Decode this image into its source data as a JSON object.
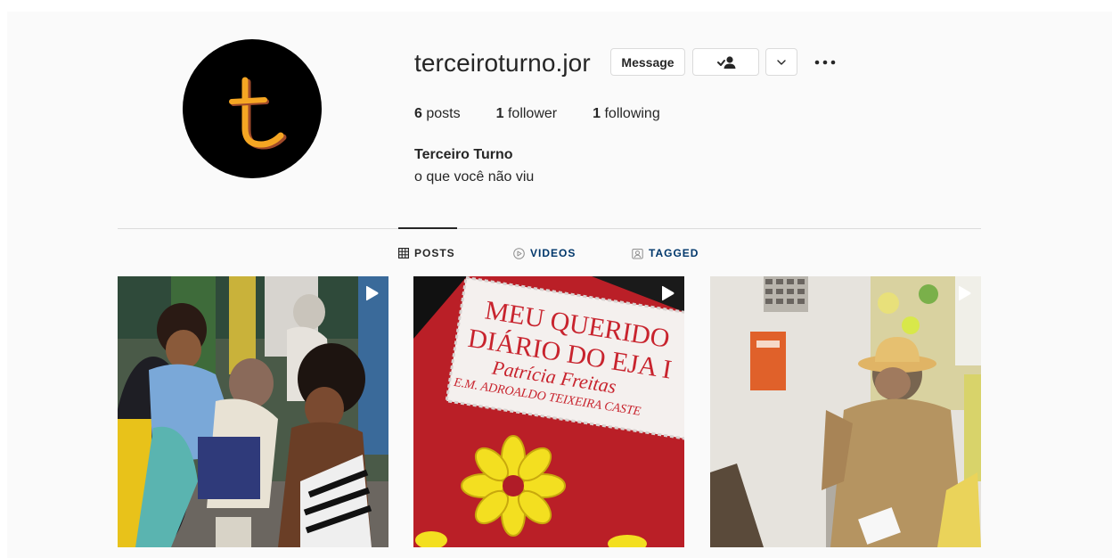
{
  "profile": {
    "username": "terceiroturno.jor",
    "full_name": "Terceiro Turno",
    "bio": "o que você não viu",
    "avatar_icon": "letter-t-logo",
    "avatar_letter": "t"
  },
  "actions": {
    "message_label": "Message",
    "follow_icon": "person-check-icon",
    "dropdown_icon": "chevron-down-icon",
    "more_icon": "more-horizontal-icon"
  },
  "stats": {
    "posts_count": "6",
    "posts_label": "posts",
    "followers_count": "1",
    "followers_label": "follower",
    "following_count": "1",
    "following_label": "following"
  },
  "tabs": [
    {
      "label": "POSTS",
      "icon": "grid-icon",
      "active": true
    },
    {
      "label": "VIDEOS",
      "icon": "play-circle-icon",
      "active": false
    },
    {
      "label": "TAGGED",
      "icon": "tag-user-icon",
      "active": false
    }
  ],
  "posts": [
    {
      "type": "video",
      "description": "people-seated-crowd"
    },
    {
      "type": "video",
      "description": "red-glitter-notebook",
      "lines": [
        "MEU QUERIDO",
        "DIÁRIO DO EJA I",
        "Patrícia Freitas",
        "E.M. ADROALDO TEIXEIRA CASTE"
      ]
    },
    {
      "type": "video",
      "description": "man-with-hat-dancing"
    }
  ],
  "colors": {
    "link_blue": "#00376b",
    "border": "#dbdbdb",
    "text": "#262626",
    "avatar_orange": "#f5a623"
  }
}
